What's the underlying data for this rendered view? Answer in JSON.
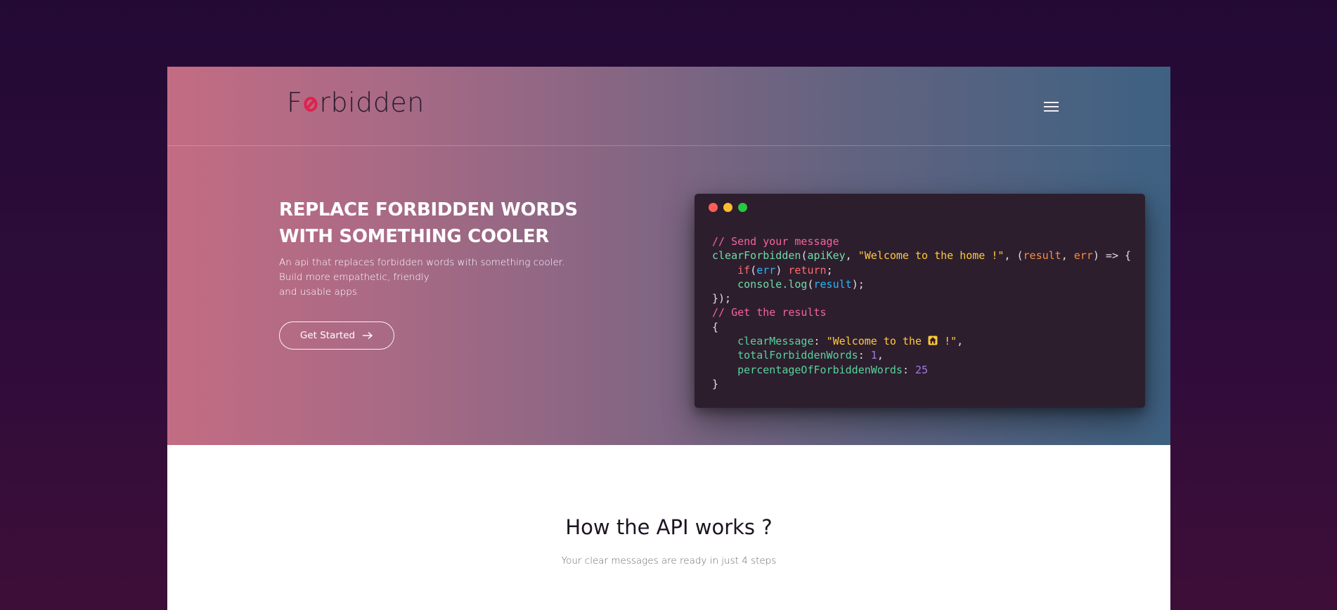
{
  "brand": {
    "name_prefix": "F",
    "name_suffix": "rbidden",
    "logo_icon": "forbidden-sign-icon",
    "logo_accent": "#e0214d"
  },
  "nav": {
    "menu_icon": "hamburger-menu-icon"
  },
  "hero": {
    "title_line1": "REPLACE FORBIDDEN WORDS",
    "title_line2": "WITH SOMETHING COOLER",
    "desc_line1": "An api that replaces forbidden words with something cooler.",
    "desc_line2": "Build more empathetic, friendly",
    "desc_line3": "and usable apps",
    "cta_label": "Get Started",
    "cta_icon": "arrow-right-icon"
  },
  "code_window": {
    "dots": [
      "#ff5f57",
      "#febc2e",
      "#28c840"
    ],
    "comment_send": "// Send your message",
    "fn_name": "clearForbidden",
    "param_apikey": "apiKey",
    "string_message": "\"Welcome to the home !\"",
    "arg_result": "result",
    "arg_err": "err",
    "kw_if": "if",
    "kw_return": "return",
    "var_err": "err",
    "console_log": "console.log",
    "var_result": "result",
    "close_call": "});",
    "comment_results": "// Get the results",
    "open_brace": "{",
    "key_clear": "clearMessage",
    "string_clear_before": "\"Welcome to the ",
    "string_clear_after": " !\"",
    "house_icon": "house-emoji-icon",
    "key_total": "totalForbiddenWords",
    "num_total": "1",
    "key_percentage": "percentageOfForbiddenWords",
    "num_percentage": "25",
    "close_brace": "}"
  },
  "how": {
    "title": "How the API works ?",
    "subtitle": "Your clear messages are ready in just 4 steps"
  }
}
